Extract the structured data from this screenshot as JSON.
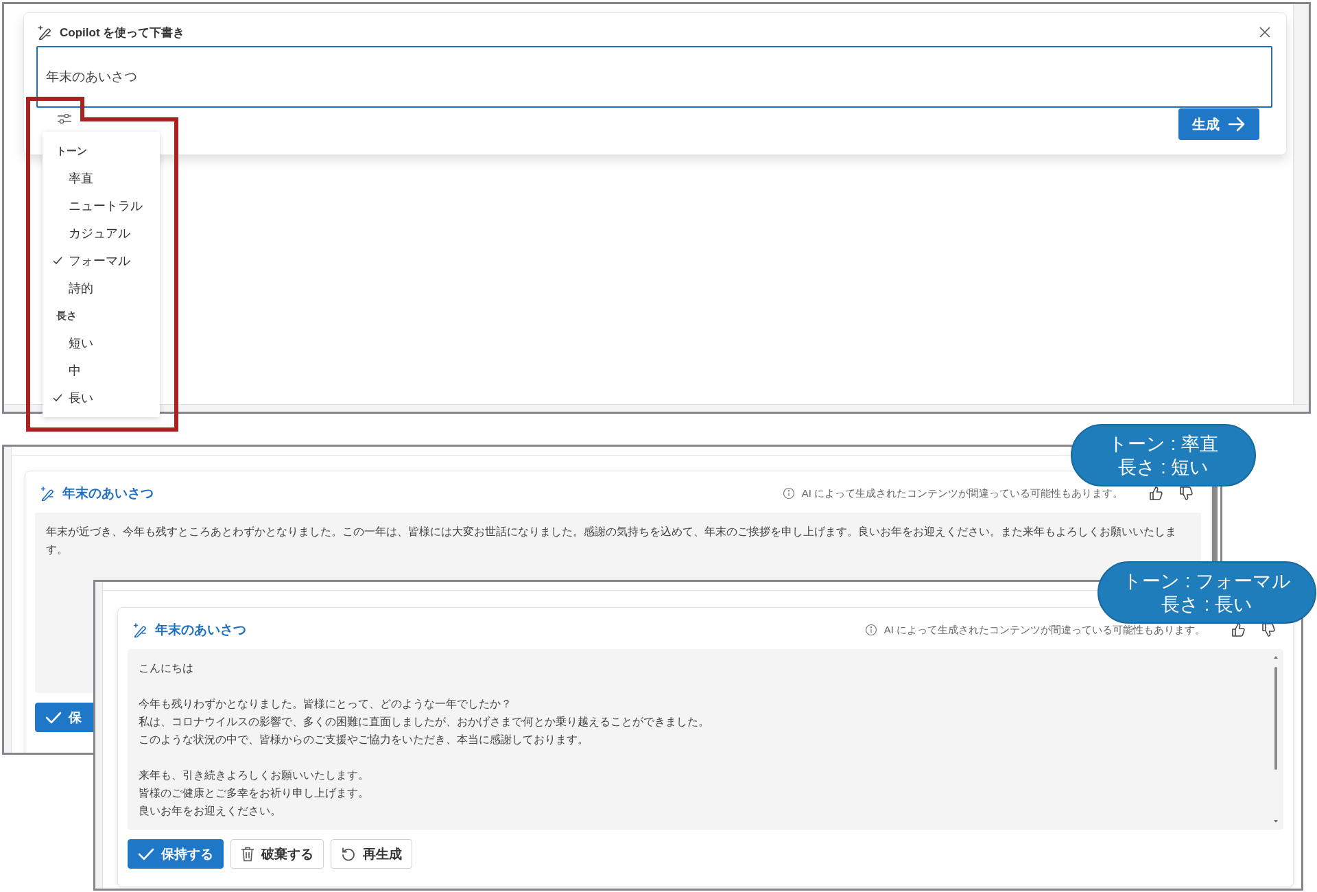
{
  "draft_panel": {
    "title": "Copilot を使って下書き",
    "prompt_value": "年末のあいさつ",
    "generate_button": "生成"
  },
  "options_menu": {
    "sections": [
      {
        "heading": "トーン",
        "items": [
          {
            "label": "率直",
            "selected": false
          },
          {
            "label": "ニュートラル",
            "selected": false
          },
          {
            "label": "カジュアル",
            "selected": false
          },
          {
            "label": "フォーマル",
            "selected": true
          },
          {
            "label": "詩的",
            "selected": false
          }
        ]
      },
      {
        "heading": "長さ",
        "items": [
          {
            "label": "短い",
            "selected": false
          },
          {
            "label": "中",
            "selected": false
          },
          {
            "label": "長い",
            "selected": true
          }
        ]
      }
    ]
  },
  "results": [
    {
      "title": "年末のあいさつ",
      "disclaimer": "AI によって生成されたコンテンツが間違っている可能性もあります。",
      "scrollable": false,
      "paragraphs": [
        [
          "年末が近づき、今年も残すところあとわずかとなりました。この一年は、皆様には大変お世話になりました。感謝の気持ちを込めて、年末のご挨拶を申し上げます。良いお年をお迎えください。また来年もよろしくお願いいたします。"
        ]
      ],
      "buttons": [
        {
          "kind": "keep",
          "label": "保"
        }
      ]
    },
    {
      "title": "年末のあいさつ",
      "disclaimer": "AI によって生成されたコンテンツが間違っている可能性もあります。",
      "scrollable": true,
      "paragraphs": [
        [
          "こんにちは"
        ],
        [
          "今年も残りわずかとなりました。皆様にとって、どのような一年でしたか？",
          "私は、コロナウイルスの影響で、多くの困難に直面しましたが、おかげさまで何とか乗り越えることができました。",
          "このような状況の中で、皆様からのご支援やご協力をいただき、本当に感謝しております。"
        ],
        [
          "来年も、引き続きよろしくお願いいたします。",
          "皆様のご健康とご多幸をお祈り申し上げます。",
          "良いお年をお迎えください。"
        ]
      ],
      "buttons": [
        {
          "kind": "keep",
          "label": "保持する"
        },
        {
          "kind": "discard",
          "label": "破棄する"
        },
        {
          "kind": "regenerate",
          "label": "再生成"
        }
      ]
    }
  ],
  "callouts": [
    {
      "lines": [
        "トーン : 率直",
        "長さ : 短い"
      ]
    },
    {
      "lines": [
        "トーン : フォーマル",
        "長さ : 長い"
      ]
    }
  ]
}
